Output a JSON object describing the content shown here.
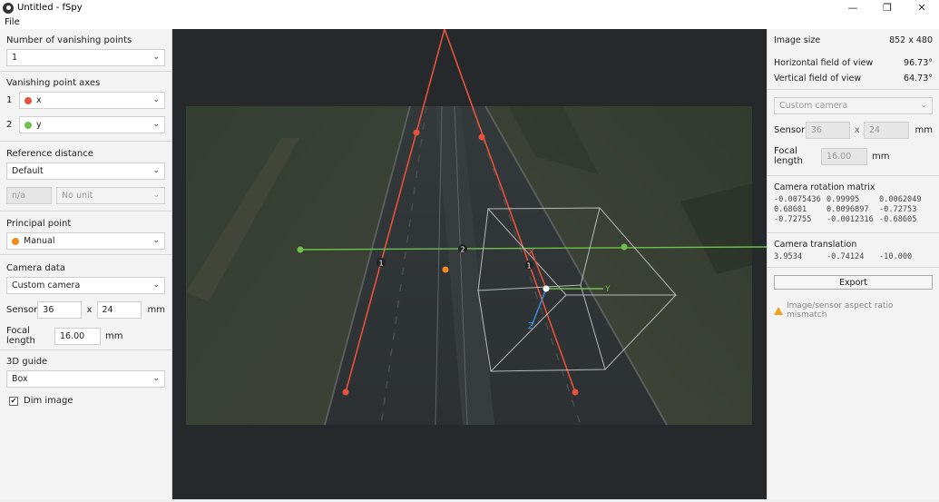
{
  "window": {
    "title": "Untitled - fSpy",
    "minimize": "—",
    "maximize": "❐",
    "close": "✕"
  },
  "menu": {
    "file": "File"
  },
  "left": {
    "num_vp_label": "Number of vanishing points",
    "num_vp_value": "1",
    "vp_axes_label": "Vanishing point axes",
    "axis1": {
      "num": "1",
      "value": "x",
      "color": "#e8523a"
    },
    "axis2": {
      "num": "2",
      "value": "y",
      "color": "#6cc24a"
    },
    "ref_dist_label": "Reference distance",
    "ref_dist_value": "Default",
    "ref_dist_input": "n/a",
    "ref_dist_unit": "No unit",
    "pp_label": "Principal point",
    "pp_value": "Manual",
    "pp_color": "#f28c1c",
    "camera_label": "Camera data",
    "camera_value": "Custom camera",
    "sensor_label": "Sensor",
    "sensor_w": "36",
    "sensor_x": "x",
    "sensor_h": "24",
    "sensor_unit": "mm",
    "focal_label": "Focal length",
    "focal_value": "16.00",
    "focal_unit": "mm",
    "guide_label": "3D guide",
    "guide_value": "Box",
    "dim_label": "Dim image",
    "dim_checked": "✔"
  },
  "canvas": {
    "labels": {
      "vp1_a": "1",
      "vp1_b": "1",
      "vp2": "2",
      "axis_x": "X",
      "axis_y": "Y",
      "axis_z": "Z"
    }
  },
  "right": {
    "image_size_label": "Image size",
    "image_size_value": "852 x 480",
    "hfov_label": "Horizontal field of view",
    "hfov_value": "96.73°",
    "vfov_label": "Vertical field of view",
    "vfov_value": "64.73°",
    "camera_value": "Custom camera",
    "sensor_label": "Sensor",
    "sensor_w": "36",
    "sensor_x": "x",
    "sensor_h": "24",
    "sensor_unit": "mm",
    "focal_label": "Focal length",
    "focal_value": "16.00",
    "focal_unit": "mm",
    "rotation_label": "Camera rotation matrix",
    "rotation": [
      [
        "-0.0075436",
        "0.99995",
        "0.0062049"
      ],
      [
        "0.68601",
        "0.0096897",
        "-0.72753"
      ],
      [
        "-0.72755",
        "-0.0012316",
        "-0.68605"
      ]
    ],
    "translation_label": "Camera translation",
    "translation": [
      "3.9534",
      "-0.74124",
      "-10.000"
    ],
    "export_label": "Export",
    "warning": "Image/sensor aspect ratio mismatch"
  }
}
